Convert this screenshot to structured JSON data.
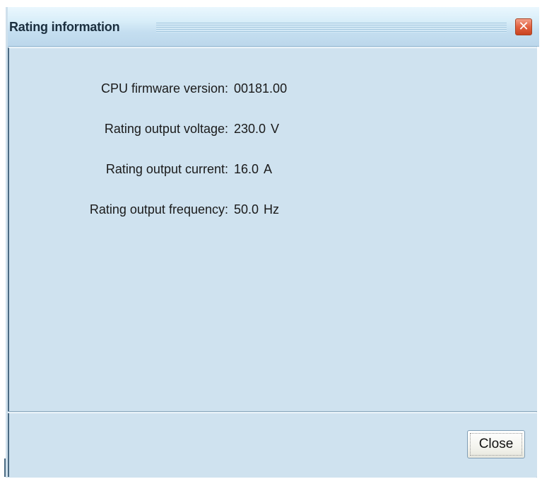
{
  "window": {
    "title": "Rating information",
    "close_icon_glyph": "✕"
  },
  "info": [
    {
      "label": "CPU firmware version:",
      "value": "00181.00",
      "unit": ""
    },
    {
      "label": "Rating output voltage:",
      "value": "230.0",
      "unit": "V"
    },
    {
      "label": "Rating output current:",
      "value": "16.0",
      "unit": "A"
    },
    {
      "label": "Rating output frequency:",
      "value": "50.0",
      "unit": "Hz"
    }
  ],
  "footer": {
    "close_label": "Close"
  },
  "colors": {
    "panel_bg": "#cfe2ef",
    "close_icon_bg": "#e2613f",
    "title_text": "#1b2f3f"
  }
}
